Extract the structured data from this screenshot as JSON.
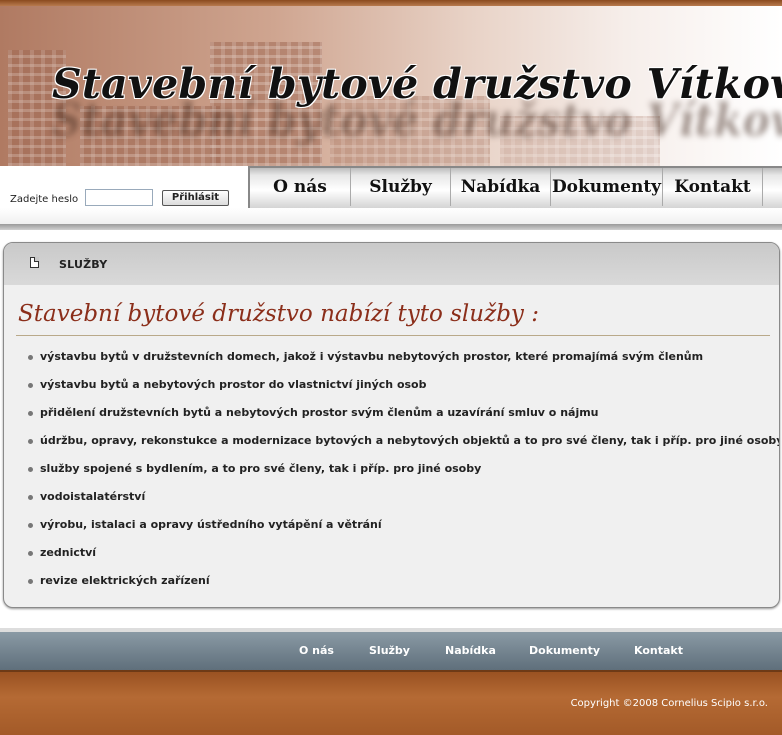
{
  "header": {
    "title": "Stavební bytové družstvo Vítkovice"
  },
  "login": {
    "label": "Zadejte heslo",
    "password_value": "",
    "button_label": "Přihlásit"
  },
  "nav": {
    "items": [
      "O nás",
      "Služby",
      "Nabídka",
      "Dokumenty",
      "Kontakt"
    ]
  },
  "section": {
    "breadcrumb": "SLUŽBY",
    "heading": "Stavební bytové družstvo nabízí tyto služby :",
    "items": [
      "výstavbu bytů v družstevních domech, jakož i výstavbu nebytových prostor, které promajímá svým členům",
      "výstavbu bytů a nebytových prostor do vlastnictví jiných osob",
      "přidělení družstevních bytů a nebytových prostor svým členům a uzavírání smluv o nájmu",
      "údržbu, opravy, rekonstukce a modernizace bytových a nebytových objektů a to pro své členy, tak i příp. pro jiné osoby",
      "služby spojené s bydlením, a to pro své členy, tak i příp. pro jiné osoby",
      "vodoistalatérství",
      "výrobu, istalaci a opravy ústředního vytápění a větrání",
      "zednictví",
      "revize elektrických zařízení"
    ]
  },
  "footer_nav": {
    "items": [
      "O nás",
      "Služby",
      "Nabídka",
      "Dokumenty",
      "Kontakt"
    ]
  },
  "footer": {
    "copyright": "Copyright ©2008 Cornelius Scipio s.r.o."
  },
  "colors": {
    "heading": "#8b2e1a",
    "footer_brown": "#a35a28",
    "footer_nav": "#6f7f8b"
  },
  "icons": [
    "page-icon"
  ]
}
